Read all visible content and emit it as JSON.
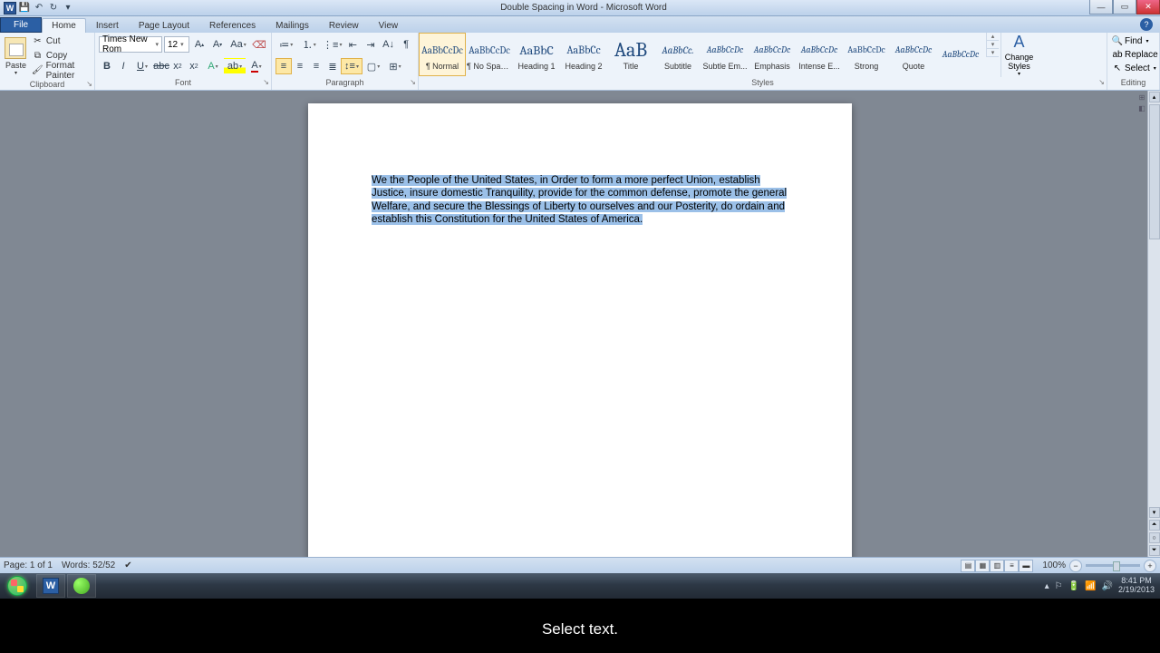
{
  "title": "Double Spacing in Word  -  Microsoft Word",
  "qat": {
    "save": "💾",
    "undo": "↶",
    "redo": "↻"
  },
  "tabs": [
    "File",
    "Home",
    "Insert",
    "Page Layout",
    "References",
    "Mailings",
    "Review",
    "View"
  ],
  "active_tab": "Home",
  "clipboard": {
    "paste": "Paste",
    "cut": "Cut",
    "copy": "Copy",
    "painter": "Format Painter",
    "label": "Clipboard"
  },
  "font": {
    "name": "Times New Rom",
    "size": "12",
    "label": "Font"
  },
  "paragraph": {
    "label": "Paragraph"
  },
  "styles": {
    "label": "Styles",
    "change": "Change Styles",
    "items": [
      {
        "preview": "AaBbCcDc",
        "name": "¶ Normal",
        "size": "11",
        "selected": true
      },
      {
        "preview": "AaBbCcDc",
        "name": "¶ No Spaci...",
        "size": "11"
      },
      {
        "preview": "AaBbC",
        "name": "Heading 1",
        "size": "14"
      },
      {
        "preview": "AaBbCc",
        "name": "Heading 2",
        "size": "12"
      },
      {
        "preview": "AaB",
        "name": "Title",
        "size": "22"
      },
      {
        "preview": "AaBbCc.",
        "name": "Subtitle",
        "size": "11",
        "italic": true
      },
      {
        "preview": "AaBbCcDc",
        "name": "Subtle Em...",
        "size": "10",
        "italic": true
      },
      {
        "preview": "AaBbCcDc",
        "name": "Emphasis",
        "size": "10",
        "italic": true
      },
      {
        "preview": "AaBbCcDc",
        "name": "Intense E...",
        "size": "10",
        "italic": true
      },
      {
        "preview": "AaBbCcDc",
        "name": "Strong",
        "size": "10"
      },
      {
        "preview": "AaBbCcDc",
        "name": "Quote",
        "size": "10",
        "italic": true
      },
      {
        "preview": "AaBbCcDc",
        "name": "",
        "size": "10",
        "italic": true
      }
    ]
  },
  "editing": {
    "find": "Find",
    "replace": "Replace",
    "select": "Select",
    "label": "Editing"
  },
  "document_text": "We the People of the United States, in Order to form a more perfect Union, establish Justice, insure domestic Tranquility,  provide for the common defense, promote the general Welfare, and secure the Blessings of Liberty to ourselves and our Posterity, do ordain and establish this Constitution for the United States of America.",
  "status": {
    "page": "Page: 1 of 1",
    "words": "Words: 52/52",
    "zoom": "100%"
  },
  "clock": {
    "time": "8:41 PM",
    "date": "2/19/2013"
  },
  "caption": "Select text."
}
